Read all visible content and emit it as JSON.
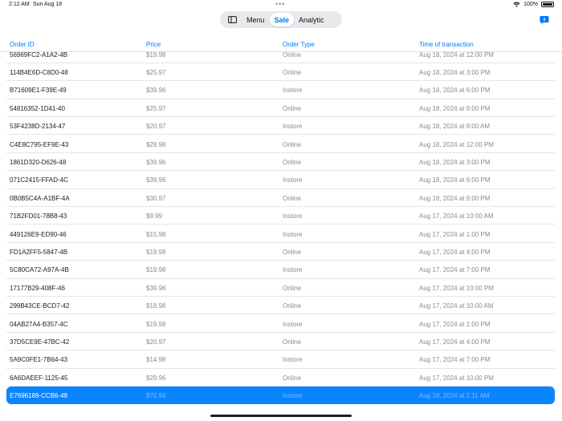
{
  "status_bar": {
    "time": "2:12 AM",
    "date": "Sun Aug 18",
    "battery_percent": "100%",
    "battery_level": 1.0
  },
  "segmented": {
    "icon": "sidebar-icon",
    "items": [
      "Menu",
      "Sale",
      "Analytic"
    ],
    "selected": "Sale"
  },
  "chat_icon": "chat-icon",
  "table": {
    "columns": [
      "Order ID",
      "Price",
      "Order Type",
      "Time of transaction"
    ],
    "rows": [
      {
        "id": "56969FC2-A1A2-4B",
        "price": "$19.98",
        "type": "Online",
        "time": "Aug 18, 2024 at 12:00 PM"
      },
      {
        "id": "114B4E6D-C8D0-48",
        "price": "$25.97",
        "type": "Online",
        "time": "Aug 18, 2024 at 3:00 PM"
      },
      {
        "id": "B71609E1-F39E-49",
        "price": "$39.96",
        "type": "Instore",
        "time": "Aug 18, 2024 at 6:00 PM"
      },
      {
        "id": "54816352-1D41-40",
        "price": "$25.97",
        "type": "Online",
        "time": "Aug 18, 2024 at 9:00 PM"
      },
      {
        "id": "53F4238D-2134-47",
        "price": "$20.97",
        "type": "Instore",
        "time": "Aug 18, 2024 at 9:00 AM"
      },
      {
        "id": "C4E8C795-EF9E-43",
        "price": "$28.98",
        "type": "Online",
        "time": "Aug 18, 2024 at 12:00 PM"
      },
      {
        "id": "1861D320-D626-48",
        "price": "$39.96",
        "type": "Online",
        "time": "Aug 18, 2024 at 3:00 PM"
      },
      {
        "id": "071C2415-FFAD-4C",
        "price": "$39.96",
        "type": "Instore",
        "time": "Aug 18, 2024 at 6:00 PM"
      },
      {
        "id": "0B0B5C4A-A1BF-4A",
        "price": "$30.97",
        "type": "Online",
        "time": "Aug 18, 2024 at 9:00 PM"
      },
      {
        "id": "71B2FD01-78B8-43",
        "price": "$9.99",
        "type": "Instore",
        "time": "Aug 17, 2024 at 10:00 AM"
      },
      {
        "id": "449126E9-ED90-46",
        "price": "$15.98",
        "type": "Instore",
        "time": "Aug 17, 2024 at 1:00 PM"
      },
      {
        "id": "FD1A2FF5-5847-4B",
        "price": "$19.98",
        "type": "Online",
        "time": "Aug 17, 2024 at 4:00 PM"
      },
      {
        "id": "5C80CA72-A97A-4B",
        "price": "$19.98",
        "type": "Instore",
        "time": "Aug 17, 2024 at 7:00 PM"
      },
      {
        "id": "17177B29-408F-46",
        "price": "$39.96",
        "type": "Online",
        "time": "Aug 17, 2024 at 10:00 PM"
      },
      {
        "id": "299B43CE-BCD7-42",
        "price": "$18.98",
        "type": "Online",
        "time": "Aug 17, 2024 at 10:00 AM"
      },
      {
        "id": "04AB27A4-B357-4C",
        "price": "$19.98",
        "type": "Instore",
        "time": "Aug 17, 2024 at 1:00 PM"
      },
      {
        "id": "37D5CE9E-47BC-42",
        "price": "$20.97",
        "type": "Online",
        "time": "Aug 17, 2024 at 4:00 PM"
      },
      {
        "id": "5A9C0FE1-7B64-43",
        "price": "$14.98",
        "type": "Instore",
        "time": "Aug 17, 2024 at 7:00 PM"
      },
      {
        "id": "6A6DAEEF-1125-45",
        "price": "$29.96",
        "type": "Online",
        "time": "Aug 17, 2024 at 10:00 PM"
      },
      {
        "id": "E7696189-CCB6-48",
        "price": "$70.94",
        "type": "Instore",
        "time": "Aug 18, 2024 at 2:11 AM",
        "selected": true
      }
    ]
  },
  "colors": {
    "accent": "#007aff",
    "selected_row": "#0a84ff",
    "muted_text": "#8a8a8e"
  }
}
